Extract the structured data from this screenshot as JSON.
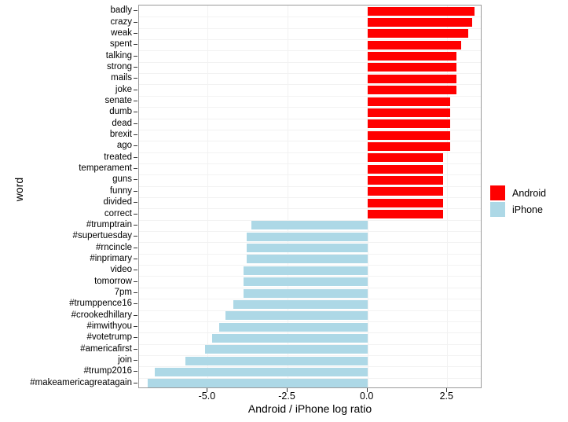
{
  "chart_data": {
    "type": "bar",
    "orientation": "horizontal",
    "title": "",
    "xlabel": "Android / iPhone log ratio",
    "ylabel": "word",
    "xlim": [
      -7.15,
      3.6
    ],
    "xticks": [
      -5.0,
      -2.5,
      0.0,
      2.5
    ],
    "xtick_labels": [
      "-5.0",
      "-2.5",
      "0.0",
      "2.5"
    ],
    "grid": true,
    "legend": {
      "position": "right",
      "entries": [
        {
          "label": "Android",
          "color": "#ff0000"
        },
        {
          "label": "iPhone",
          "color": "#add8e6"
        }
      ]
    },
    "categories": [
      "badly",
      "crazy",
      "weak",
      "spent",
      "talking",
      "strong",
      "mails",
      "joke",
      "senate",
      "dumb",
      "dead",
      "brexit",
      "ago",
      "treated",
      "temperament",
      "guns",
      "funny",
      "divided",
      "correct",
      "#trumptrain",
      "#supertuesday",
      "#rncincle",
      "#inprimary",
      "video",
      "tomorrow",
      "7pm",
      "#trumppence16",
      "#crookedhillary",
      "#imwithyou",
      "#votetrump",
      "#americafirst",
      "join",
      "#trump2016",
      "#makeamericagreatagain"
    ],
    "values": [
      3.35,
      3.27,
      3.16,
      2.93,
      2.8,
      2.8,
      2.8,
      2.8,
      2.6,
      2.6,
      2.6,
      2.6,
      2.6,
      2.37,
      2.37,
      2.37,
      2.37,
      2.37,
      2.37,
      -3.62,
      -3.77,
      -3.77,
      -3.77,
      -3.88,
      -3.88,
      -3.88,
      -4.21,
      -4.45,
      -4.65,
      -4.85,
      -5.08,
      -5.69,
      -6.67,
      -6.87
    ],
    "groups": [
      "Android",
      "Android",
      "Android",
      "Android",
      "Android",
      "Android",
      "Android",
      "Android",
      "Android",
      "Android",
      "Android",
      "Android",
      "Android",
      "Android",
      "Android",
      "Android",
      "Android",
      "Android",
      "Android",
      "iPhone",
      "iPhone",
      "iPhone",
      "iPhone",
      "iPhone",
      "iPhone",
      "iPhone",
      "iPhone",
      "iPhone",
      "iPhone",
      "iPhone",
      "iPhone",
      "iPhone",
      "iPhone",
      "iPhone"
    ],
    "colors": {
      "android": "#ff0000",
      "iphone": "#add8e6"
    }
  }
}
